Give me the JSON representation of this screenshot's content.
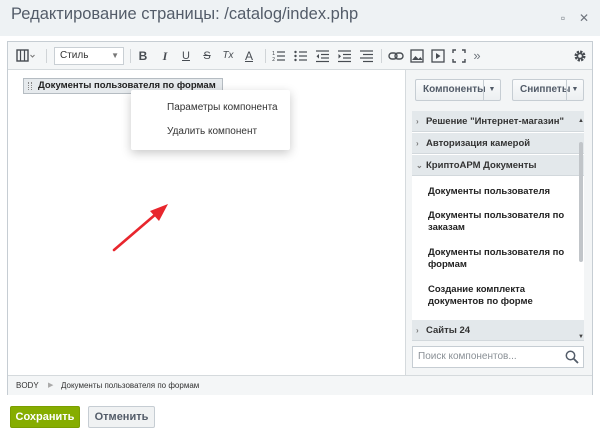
{
  "window": {
    "title": "Редактирование страницы: /catalog/index.php",
    "minimize_glyph": "▫",
    "close_glyph": "✕"
  },
  "toolbar": {
    "style_select_value": "Стиль",
    "buttons": [
      {
        "icon": "view-mode-icon"
      },
      {
        "label": "B",
        "icon": "bold-icon"
      },
      {
        "label": "I",
        "icon": "italic-icon"
      },
      {
        "label": "U",
        "icon": "underline-icon"
      },
      {
        "label": "S",
        "icon": "strikethrough-icon"
      },
      {
        "label": "Tx",
        "icon": "clear-format-icon"
      },
      {
        "label": "A",
        "icon": "text-color-icon"
      },
      {
        "icon": "ordered-list-icon"
      },
      {
        "icon": "unordered-list-icon"
      },
      {
        "icon": "outdent-icon"
      },
      {
        "icon": "indent-icon"
      },
      {
        "icon": "align-icon"
      },
      {
        "icon": "link-icon"
      },
      {
        "icon": "image-icon"
      },
      {
        "icon": "video-icon"
      },
      {
        "icon": "fullscreen-icon"
      },
      {
        "label": "»",
        "icon": "more-icon"
      },
      {
        "icon": "gear-icon"
      }
    ]
  },
  "content": {
    "component_chip": "Документы пользователя по формам",
    "context_menu": [
      "Параметры компонента",
      "Удалить компонент"
    ]
  },
  "sidebar": {
    "tabs": [
      "Компоненты",
      "Сниппеты"
    ],
    "sections": [
      {
        "label": "Решение \"Интернет-магазин\"",
        "expanded": false
      },
      {
        "label": "Авторизация камерой",
        "expanded": false
      },
      {
        "label": "КриптоАРМ Документы",
        "expanded": true
      },
      {
        "label": "Сайты 24",
        "expanded": false
      }
    ],
    "items": [
      "Документы пользователя",
      "Документы пользователя по заказам",
      "Документы пользователя по формам",
      "Создание комплекта документов по форме"
    ],
    "search_placeholder": "Поиск компонентов..."
  },
  "statusbar": {
    "tag": "BODY",
    "path": "Документы пользователя по формам"
  },
  "footer": {
    "save_label": "Сохранить",
    "cancel_label": "Отменить"
  },
  "colors": {
    "accent_green": "#86ad00",
    "annotation_arrow": "#e8262d"
  }
}
